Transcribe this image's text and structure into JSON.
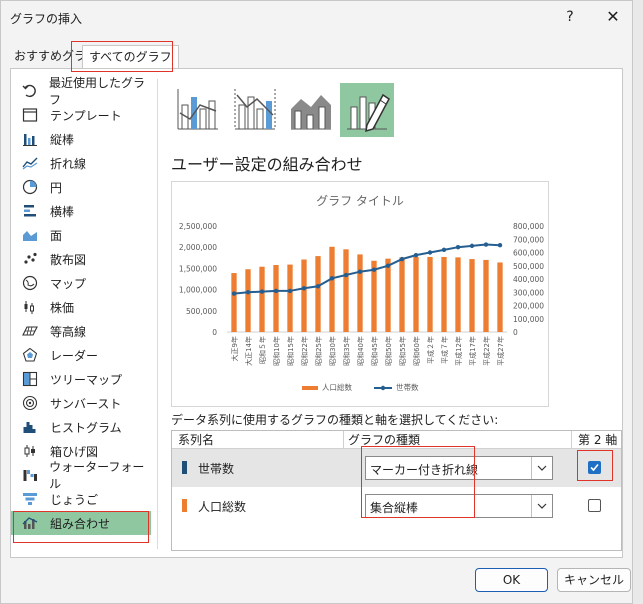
{
  "window": {
    "title": "グラフの挿入",
    "help": "?",
    "close": "✕"
  },
  "tabs": [
    {
      "label": "おすすめグラフ"
    },
    {
      "label": "すべてのグラフ"
    }
  ],
  "sidebar": {
    "items": [
      {
        "label": "最近使用したグラフ",
        "icon": "recent-icon"
      },
      {
        "label": "テンプレート",
        "icon": "template-icon"
      },
      {
        "label": "縦棒",
        "icon": "column-chart-icon"
      },
      {
        "label": "折れ線",
        "icon": "line-chart-icon"
      },
      {
        "label": "円",
        "icon": "pie-chart-icon"
      },
      {
        "label": "横棒",
        "icon": "bar-chart-icon"
      },
      {
        "label": "面",
        "icon": "area-chart-icon"
      },
      {
        "label": "散布図",
        "icon": "scatter-chart-icon"
      },
      {
        "label": "マップ",
        "icon": "map-chart-icon"
      },
      {
        "label": "株価",
        "icon": "stock-chart-icon"
      },
      {
        "label": "等高線",
        "icon": "surface-chart-icon"
      },
      {
        "label": "レーダー",
        "icon": "radar-chart-icon"
      },
      {
        "label": "ツリーマップ",
        "icon": "treemap-chart-icon"
      },
      {
        "label": "サンバースト",
        "icon": "sunburst-chart-icon"
      },
      {
        "label": "ヒストグラム",
        "icon": "histogram-chart-icon"
      },
      {
        "label": "箱ひげ図",
        "icon": "box-whisker-chart-icon"
      },
      {
        "label": "ウォーターフォール",
        "icon": "waterfall-chart-icon"
      },
      {
        "label": "じょうご",
        "icon": "funnel-chart-icon"
      },
      {
        "label": "組み合わせ",
        "icon": "combo-chart-icon",
        "selected": true
      }
    ]
  },
  "main": {
    "subtypes": [
      {
        "icon": "combo-clustered-line-icon"
      },
      {
        "icon": "combo-clustered-line-secondary-icon"
      },
      {
        "icon": "combo-stacked-area-icon"
      },
      {
        "icon": "custom-combo-icon",
        "selected": true
      }
    ],
    "section_title": "ユーザー設定の組み合わせ",
    "instruction": "データ系列に使用するグラフの種類と軸を選択してください:",
    "grid_headers": {
      "name": "系列名",
      "type": "グラフの種類",
      "secondary": "第 2 軸"
    },
    "series_rows": [
      {
        "name": "世帯数",
        "color": "#1f4e79",
        "type": "マーカー付き折れ線",
        "secondary_axis": true
      },
      {
        "name": "人口総数",
        "color": "#ed7d31",
        "type": "集合縦棒",
        "secondary_axis": false
      }
    ]
  },
  "chart_data": {
    "type": "bar",
    "title": "グラフ タイトル",
    "categories": [
      "大正9年",
      "大正14年",
      "昭和５年",
      "昭和10年",
      "昭和15年",
      "昭和22年",
      "昭和25年",
      "昭和30年",
      "昭和35年",
      "昭和40年",
      "昭和45年",
      "昭和50年",
      "昭和55年",
      "昭和60年",
      "平成２年",
      "平成７年",
      "平成12年",
      "平成17年",
      "平成22年",
      "平成27年"
    ],
    "series": [
      {
        "name": "人口総数",
        "kind": "bar",
        "axis": "primary",
        "color": "#ed7d31",
        "values": [
          1390000,
          1480000,
          1540000,
          1580000,
          1590000,
          1710000,
          1790000,
          2010000,
          1950000,
          1830000,
          1680000,
          1730000,
          1760000,
          1770000,
          1770000,
          1770000,
          1760000,
          1720000,
          1700000,
          1640000
        ]
      },
      {
        "name": "世帯数",
        "kind": "line-markers",
        "axis": "secondary",
        "color": "#255e91",
        "values": [
          290000,
          300000,
          305000,
          310000,
          310000,
          330000,
          345000,
          405000,
          430000,
          455000,
          470000,
          500000,
          550000,
          580000,
          600000,
          620000,
          640000,
          650000,
          660000,
          655000
        ]
      }
    ],
    "ylim": [
      0,
      2500000
    ],
    "y_ticks": [
      "0",
      "500,000",
      "1,000,000",
      "1,500,000",
      "2,000,000",
      "2,500,000"
    ],
    "y2lim": [
      0,
      800000
    ],
    "y2_ticks": [
      "0",
      "100,000",
      "200,000",
      "300,000",
      "400,000",
      "500,000",
      "600,000",
      "700,000",
      "800,000"
    ],
    "legend": [
      {
        "label": "人口総数",
        "color": "#ed7d31",
        "marker": "bar"
      },
      {
        "label": "世帯数",
        "color": "#255e91",
        "marker": "line"
      }
    ],
    "legend_position": "bottom",
    "grid": false
  },
  "buttons": {
    "ok": "OK",
    "cancel": "キャンセル"
  },
  "accent": {
    "selection": "#8fc7a0",
    "highlight": "#e0332a",
    "primary": "#1a5fb4"
  }
}
